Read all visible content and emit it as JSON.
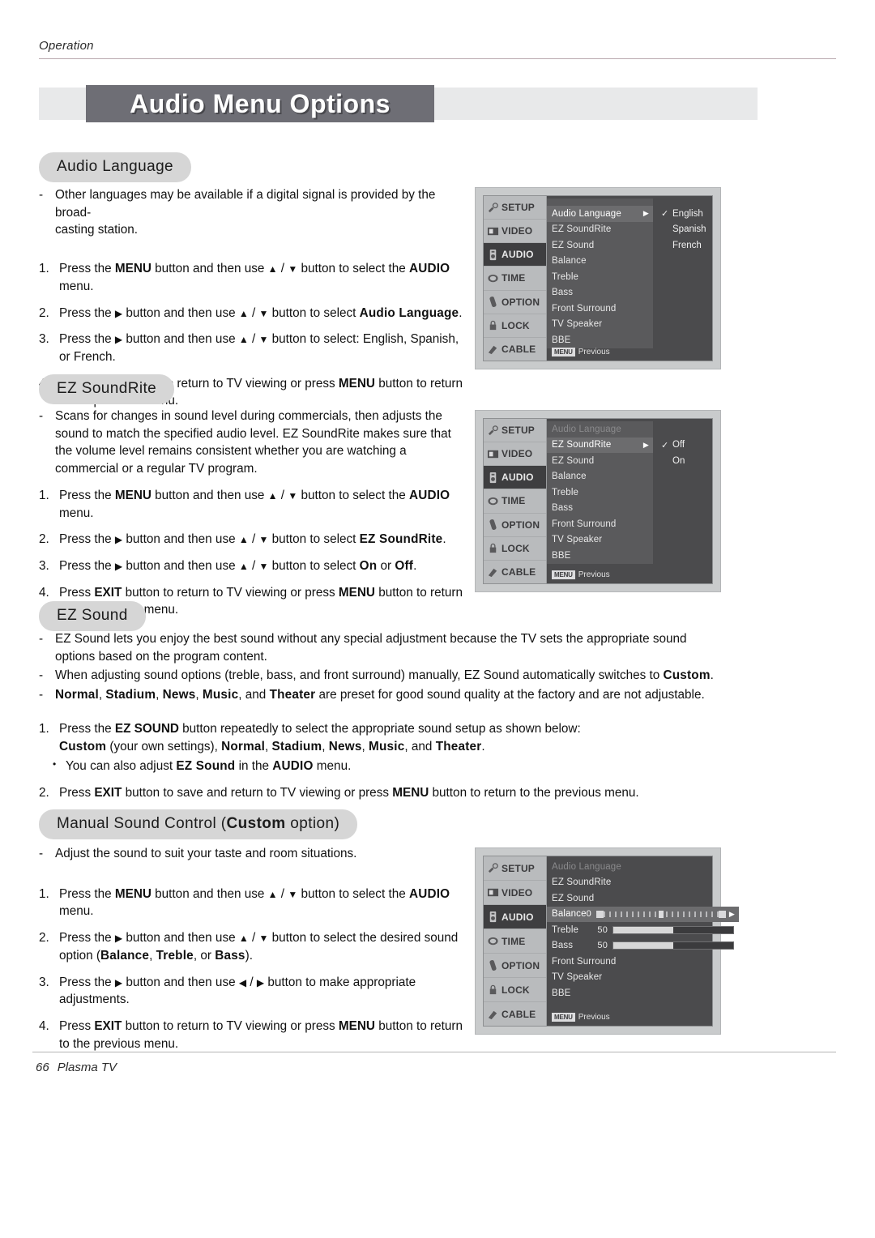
{
  "runhead": "Operation",
  "title": "Audio Menu Options",
  "footer": {
    "page": "66",
    "label": "Plasma TV"
  },
  "sections": [
    {
      "id": "audio-language",
      "pill": "Audio Language",
      "dashes": [
        "Other languages may be available if a digital signal is provided by the broad-casting station."
      ],
      "steps": [
        "1. Press the MENU button and then use ▲ / ▼ button to select the AUDIO menu.",
        "2. Press the ▶ button and then use ▲ / ▼ button to select Audio Language.",
        "3. Press the ▶ button and then use ▲ / ▼ button to select: English, Spanish, or French.",
        "4. Press EXIT button to return to TV viewing or press MENU button to return to the previous menu."
      ]
    },
    {
      "id": "ez-soundrite",
      "pill": "EZ SoundRite",
      "dashes": [
        "Scans for changes in sound level during commercials, then adjusts the sound to match the specified audio level. EZ SoundRite makes sure that the volume level remains consistent whether you are watching a commercial or a regular TV program."
      ],
      "steps": [
        "1. Press the MENU button and then use ▲ / ▼ button to select the AUDIO menu.",
        "2. Press the ▶ button and then use ▲ / ▼ button to select EZ SoundRite.",
        "3. Press the ▶ button and then use ▲ / ▼ button to select On or Off.",
        "4. Press EXIT button to return to TV viewing or press MENU button to return to the previous menu."
      ]
    },
    {
      "id": "ez-sound",
      "pill": "EZ Sound",
      "dashes": [
        "EZ Sound lets you enjoy the best sound without any special adjustment because the TV sets the appropriate sound options based on the program content.",
        "When adjusting sound options (treble, bass, and front surround) manually, EZ Sound automatically switches to Custom.",
        "Normal, Stadium, News, Music, and Theater are preset for good sound quality at the factory and are not adjustable."
      ],
      "steps": [
        "1. Press the EZ SOUND button repeatedly to select the appropriate sound setup as shown below: Custom (your own settings), Normal, Stadium, News, Music, and Theater.",
        "• You can also adjust EZ Sound in the AUDIO menu.",
        "2. Press EXIT button to save and return to TV viewing or press MENU button to return to the previous menu."
      ]
    },
    {
      "id": "manual-sound-control",
      "pill_plain_1": "Manual Sound Control (",
      "pill_bold": "Custom",
      "pill_plain_2": " option)",
      "dashes": [
        "Adjust the sound to suit your taste and room situations."
      ],
      "steps": [
        "1. Press the MENU button and then use ▲ / ▼ button to select the AUDIO menu.",
        "2. Press the ▶ button and then use ▲ / ▼ button to select the desired sound option (Balance, Treble, or Bass).",
        "3. Press the ▶ button and then use ◀ / ▶ button to make appropriate adjustments.",
        "4. Press EXIT button to return to TV viewing or press MENU button to return to the previous menu."
      ]
    }
  ],
  "osd_common": {
    "sidebar": [
      "SETUP",
      "VIDEO",
      "AUDIO",
      "TIME",
      "OPTION",
      "LOCK",
      "CABLE"
    ],
    "active_sidebar": "AUDIO",
    "menu_items": [
      "Audio Language",
      "EZ SoundRite",
      "EZ Sound",
      "Balance",
      "Treble",
      "Bass",
      "Front Surround",
      "TV Speaker",
      "BBE"
    ],
    "previous_key": "MENU",
    "previous_label": "Previous"
  },
  "osd": [
    {
      "id": "osd-audio-language",
      "selected_item": "Audio Language",
      "dimmed_items": [],
      "submenu": [
        {
          "label": "English",
          "checked": true
        },
        {
          "label": "Spanish",
          "checked": false
        },
        {
          "label": "French",
          "checked": false
        }
      ]
    },
    {
      "id": "osd-ez-soundrite",
      "selected_item": "EZ SoundRite",
      "dimmed_items": [
        "Audio Language"
      ],
      "submenu": [
        {
          "label": "Off",
          "checked": true
        },
        {
          "label": "On",
          "checked": false
        }
      ]
    },
    {
      "id": "osd-manual-sound",
      "selected_item": "Balance",
      "dimmed_items": [
        "Audio Language"
      ],
      "submenu": [],
      "values": [
        {
          "item": "Balance",
          "value": "0",
          "control": "balance"
        },
        {
          "item": "Treble",
          "value": "50",
          "control": "bar",
          "percent": 50
        },
        {
          "item": "Bass",
          "value": "50",
          "control": "bar",
          "percent": 50
        }
      ]
    }
  ],
  "colors": {
    "banner_block": "#6e6e75",
    "banner_bg": "#e8e9ea",
    "pill": "#d6d6d6",
    "osd_bg": "#4b4b4d",
    "osd_sidebar": "#b9bbbd",
    "osd_selected": "#6c6c6e",
    "rule": "#b9a8ae"
  }
}
